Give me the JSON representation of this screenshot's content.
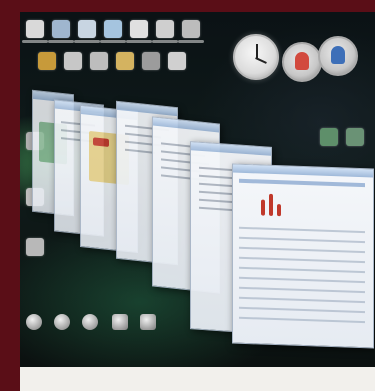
{
  "scene": {
    "description_tags": [
      "desktop-wallpaper",
      "stacked-windows",
      "desktop-gadgets"
    ],
    "colors": {
      "frame": "#5a0e17",
      "caption_strip": "#f2f0ec"
    }
  },
  "icons": {
    "top_row": [
      "app-icon",
      "app-icon",
      "app-icon",
      "app-icon",
      "app-icon",
      "app-icon",
      "app-icon"
    ],
    "second_row": [
      "folder-icon",
      "folder-icon",
      "folder-icon",
      "folder-icon",
      "folder-icon",
      "folder-icon"
    ],
    "left_column": [
      "app-icon",
      "app-icon",
      "app-icon"
    ],
    "bottom_row": [
      "disc-icon",
      "disc-icon",
      "disc-icon",
      "disc-icon",
      "disc-icon"
    ],
    "right_side": [
      "app-icon",
      "app-icon"
    ]
  },
  "gadgets": {
    "clock": "clock-gadget-icon",
    "contacts": [
      "contact-gadget-icon",
      "contact-gadget-icon"
    ]
  }
}
